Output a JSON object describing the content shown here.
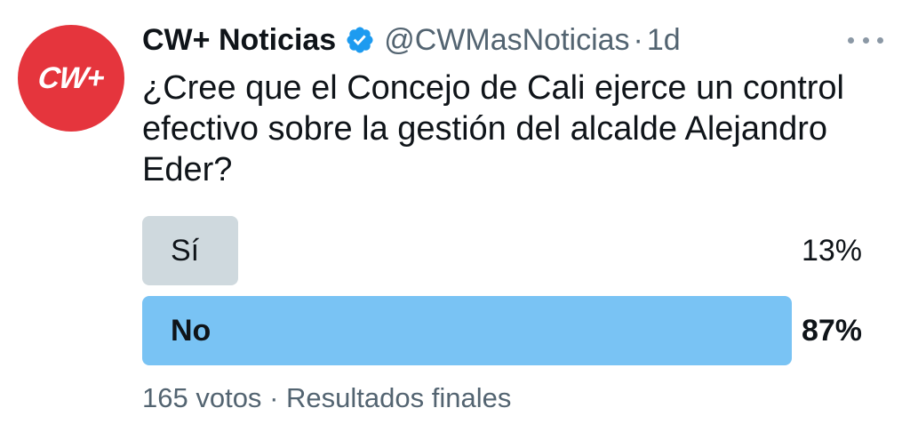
{
  "author": {
    "name": "CW+ Noticias",
    "avatar_text": "CW+",
    "verified": true,
    "handle": "@CWMasNoticias",
    "separator": "·",
    "time": "1d"
  },
  "tweet": {
    "text": "¿Cree que el Concejo de Cali ejerce un control efectivo sobre la gestión del alcalde Alejandro Eder?"
  },
  "poll": {
    "options": [
      {
        "label": "Sí",
        "percent_text": "13%",
        "percent": 13,
        "winner": false
      },
      {
        "label": "No",
        "percent_text": "87%",
        "percent": 87,
        "winner": true
      }
    ],
    "votes": "165 votos",
    "separator": "·",
    "status": "Resultados finales"
  },
  "colors": {
    "avatar_bg": "#e5353d",
    "verified_blue": "#1d9bf0",
    "winner_bar": "#79c3f4",
    "loser_bar": "#cfd9de",
    "secondary_text": "#536471"
  },
  "icons": {
    "verified": "verified-badge-icon",
    "more": "more-options-icon"
  }
}
